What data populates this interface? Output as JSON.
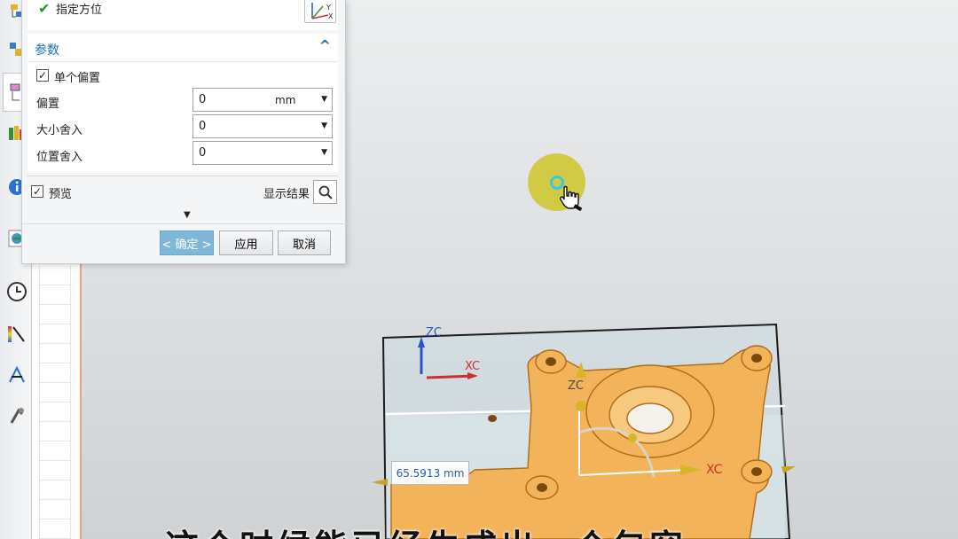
{
  "dialog": {
    "orientation_label": "指定方位",
    "params_title": "参数",
    "single_offset_label": "单个偏置",
    "offset_label": "偏置",
    "offset_value": "0",
    "offset_unit": "mm",
    "size_round_label": "大小舍入",
    "size_round_value": "0",
    "position_round_label": "位置舍入",
    "position_round_value": "0",
    "preview_label": "预览",
    "show_result_label": "显示结果",
    "ok_label": "< 确定 >",
    "apply_label": "应用",
    "cancel_label": "取消"
  },
  "viewport": {
    "measure_value": "65.5913 mm",
    "axes": {
      "xc_upper": "XC",
      "zc_upper": "ZC",
      "zc_middle": "ZC",
      "xc_right": "XC"
    }
  },
  "subtitle": "这个时候能已经生成出一个包容",
  "colors": {
    "accent_blue": "#1c6fb2",
    "ok_button": "#7fb8d6",
    "part_orange": "#f2b35a",
    "cursor_halo": "#cec628"
  },
  "icons": [
    "check-icon",
    "csys-orient-icon",
    "collapse-chevron-icon",
    "search-icon",
    "expand-arrow-icon",
    "hand-cursor-icon"
  ]
}
